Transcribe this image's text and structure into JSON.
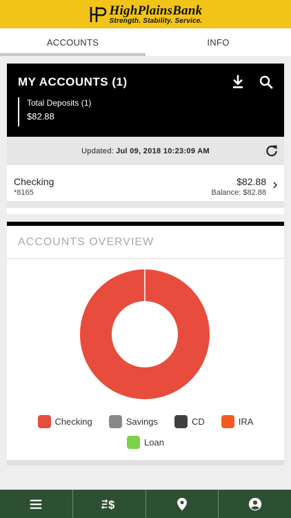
{
  "brand": {
    "name": "HighPlainsBank",
    "tagline": "Strength. Stability. Service.",
    "color": "#f2c417"
  },
  "tabs": [
    {
      "label": "ACCOUNTS",
      "active": true
    },
    {
      "label": "INFO",
      "active": false
    }
  ],
  "accounts_panel": {
    "title": "MY ACCOUNTS (1)",
    "total_label": "Total Deposits (1)",
    "total_value": "$82.88",
    "updated_label": "Updated:",
    "updated_value": "Jul 09, 2018 10:23:09 AM",
    "icons": [
      "download-icon",
      "search-icon",
      "refresh-icon"
    ]
  },
  "account_list": [
    {
      "name": "Checking",
      "number": "*8165",
      "amount": "$82.88",
      "balance": "Balance: $82.88"
    }
  ],
  "overview": {
    "title": "ACCOUNTS OVERVIEW",
    "legend": [
      {
        "label": "Checking",
        "color": "#e84c3d"
      },
      {
        "label": "Savings",
        "color": "#888888"
      },
      {
        "label": "CD",
        "color": "#404040"
      },
      {
        "label": "IRA",
        "color": "#f25a22"
      },
      {
        "label": "Loan",
        "color": "#7ed04b"
      }
    ]
  },
  "chart_data": {
    "type": "pie",
    "categories": [
      "Checking",
      "Savings",
      "CD",
      "IRA",
      "Loan"
    ],
    "values": [
      82.88,
      0,
      0,
      0,
      0
    ],
    "colors": [
      "#e84c3d",
      "#888888",
      "#404040",
      "#f25a22",
      "#7ed04b"
    ],
    "donut": true
  },
  "bottom_nav": {
    "color": "#2e5032",
    "items": [
      "menu-icon",
      "transfer-icon",
      "location-icon",
      "profile-icon"
    ]
  }
}
